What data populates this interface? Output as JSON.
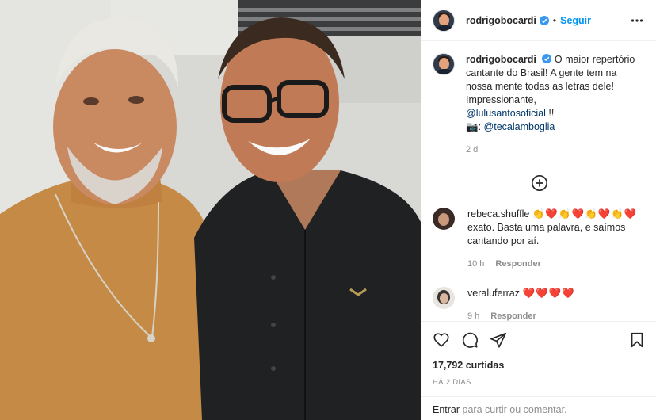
{
  "header": {
    "username": "rodrigobocardi",
    "separator": "•",
    "follow_label": "Seguir",
    "icons": {
      "verified": "verified-badge-icon",
      "more": "more-options-icon"
    }
  },
  "caption": {
    "username": "rodrigobocardi",
    "text": "O maior repertório cantante do Brasil! A gente tem na nossa mente todas as letras dele! Impressionante,",
    "mention": "@lulusantosoficial",
    "after_mention": " !!",
    "camera_emoji": "📷:",
    "photo_credit": "@tecalamboglia",
    "time": "2 d"
  },
  "load_more_icon": "plus-circle-icon",
  "comments": [
    {
      "username": "rebeca.shuffle",
      "emojis": "👏❤️👏❤️👏❤️👏❤️",
      "text": "exato. Basta uma palavra, e saímos cantando por aí.",
      "time": "10 h",
      "reply_label": "Responder"
    },
    {
      "username": "veraluferraz",
      "emojis": "❤️❤️❤️❤️",
      "text": "",
      "time": "9 h",
      "reply_label": "Responder"
    }
  ],
  "actions": {
    "icons": [
      "heart-icon",
      "comment-icon",
      "share-icon",
      "bookmark-icon"
    ],
    "likes": "17,792 curtidas",
    "ago": "HÁ 2 DIAS"
  },
  "add_comment": {
    "login_label": "Entrar",
    "rest": " para curtir ou comentar."
  },
  "colors": {
    "accent": "#0095f6",
    "link": "#00376b",
    "muted": "#8e8e8e",
    "heart": "#ed4956"
  }
}
